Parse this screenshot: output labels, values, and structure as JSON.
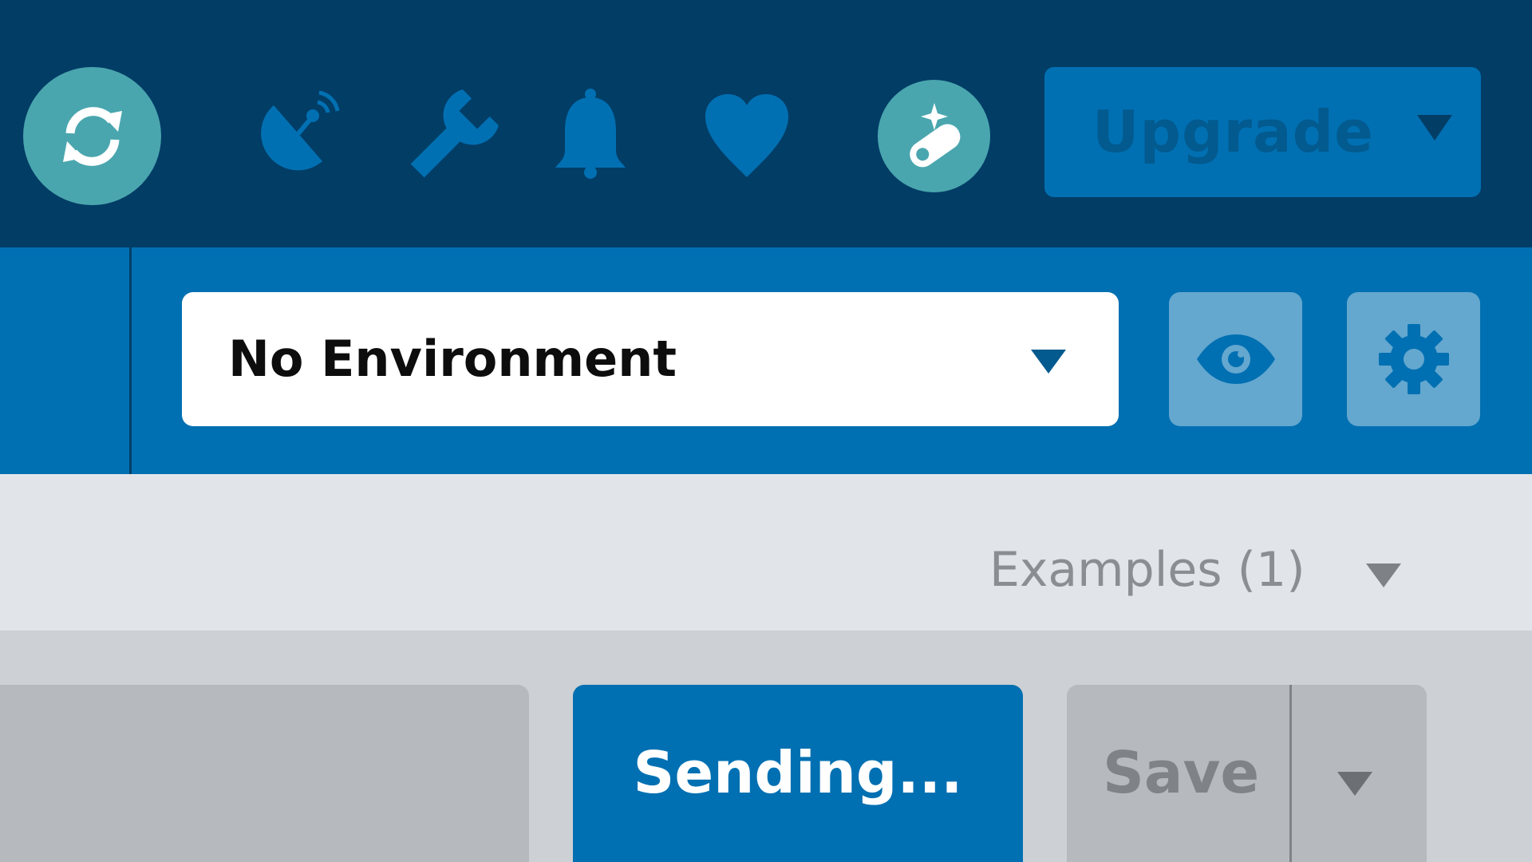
{
  "topbar": {
    "icons": [
      "sync-icon",
      "satellite-dish-icon",
      "wrench-icon",
      "bell-icon",
      "heart-icon",
      "comet-icon"
    ],
    "upgrade_label": "Upgrade"
  },
  "environment": {
    "selected": "No Environment",
    "buttons": [
      "eye-icon",
      "gear-icon"
    ]
  },
  "examples": {
    "label": "Examples (1)"
  },
  "request": {
    "send_label": "Sending...",
    "save_label": "Save"
  },
  "colors": {
    "topbar_bg": "#023d66",
    "accent_blue": "#0170b2",
    "teal": "#4aa6ae",
    "light_panel": "#e1e4e8",
    "gray_panel": "#cdd0d4"
  }
}
